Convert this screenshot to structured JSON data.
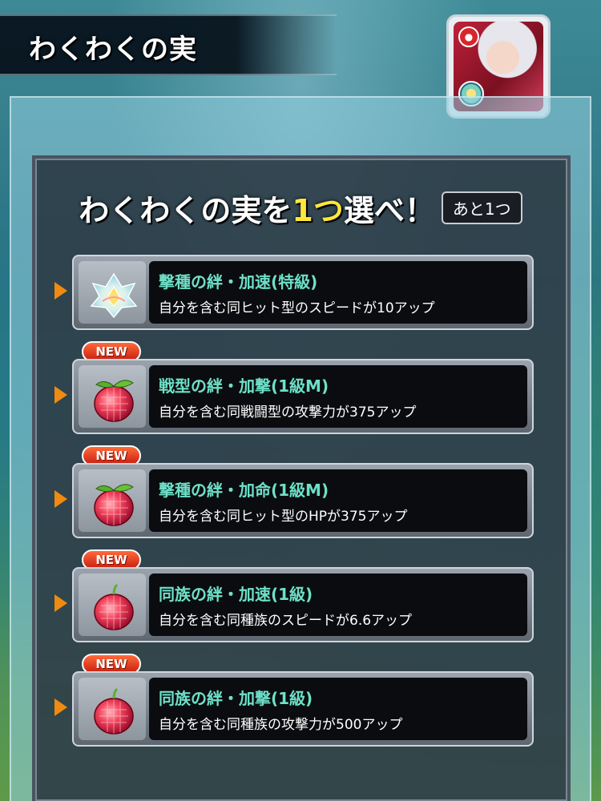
{
  "header": {
    "title": "わくわくの実"
  },
  "prompt": {
    "before": "わくわくの実を",
    "number": "1つ",
    "after": "選べ！",
    "remaining": "あと1つ"
  },
  "options": [
    {
      "title": "撃種の絆・加速(特級)",
      "desc": "自分を含む同ヒット型のスピードが10アップ",
      "is_new": false,
      "fruit": "lotus-fruit-icon"
    },
    {
      "title": "戦型の絆・加撃(1級M)",
      "desc": "自分を含む同戦闘型の攻撃力が375アップ",
      "is_new": true,
      "fruit": "red-fruit-icon"
    },
    {
      "title": "撃種の絆・加命(1級M)",
      "desc": "自分を含む同ヒット型のHPが375アップ",
      "is_new": true,
      "fruit": "red-fruit-icon"
    },
    {
      "title": "同族の絆・加速(1級)",
      "desc": "自分を含む同種族のスピードが6.6アップ",
      "is_new": true,
      "fruit": "red-fruit-icon"
    },
    {
      "title": "同族の絆・加撃(1級)",
      "desc": "自分を含む同種族の攻撃力が500アップ",
      "is_new": true,
      "fruit": "red-fruit-icon"
    }
  ],
  "new_label": "NEW",
  "colors": {
    "title_teal": "#6ee0c8",
    "accent_yellow": "#ffe63c",
    "arrow_orange": "#f08a10"
  }
}
